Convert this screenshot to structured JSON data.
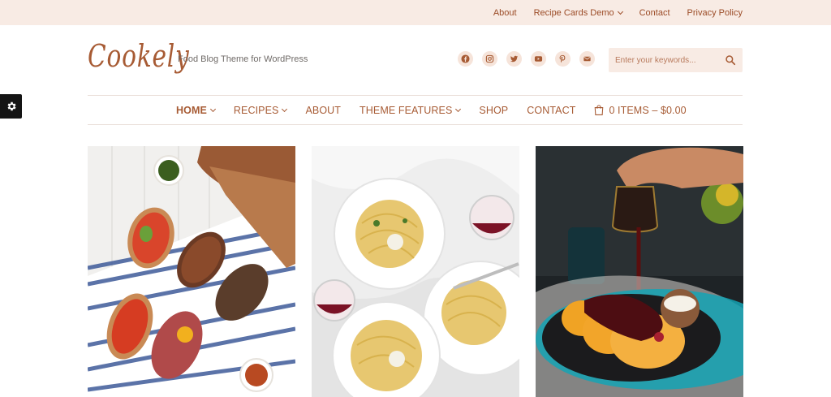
{
  "topbar": {
    "links": [
      "About",
      "Recipe Cards Demo",
      "Contact",
      "Privacy Policy"
    ]
  },
  "header": {
    "logo": "Cookely",
    "tagline": "Food Blog Theme for WordPress",
    "social_icons": [
      "facebook-icon",
      "instagram-icon",
      "twitter-icon",
      "youtube-icon",
      "pinterest-icon",
      "email-icon"
    ],
    "search_placeholder": "Enter your keywords..."
  },
  "nav": {
    "items": [
      "HOME",
      "RECIPES",
      "ABOUT",
      "THEME FEATURES",
      "SHOP",
      "CONTACT"
    ],
    "cart": "0 ITEMS – $0.00"
  },
  "posts": [
    {
      "image": "bruschetta-photo"
    },
    {
      "image": "pasta-plates-photo"
    },
    {
      "image": "pancakes-syrup-photo"
    }
  ],
  "colors": {
    "accent": "#a75b34",
    "topbar_bg": "#f8ebe4"
  }
}
